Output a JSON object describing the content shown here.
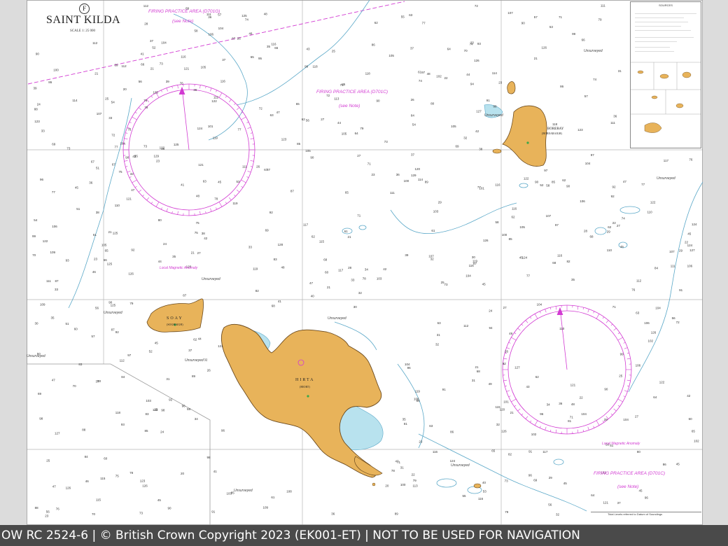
{
  "chart": {
    "title": "SAINT KILDA",
    "scale": "SCALE 1: 25 000",
    "panel_letter": "F"
  },
  "firing_areas": [
    {
      "label": "FIRING PRACTICE AREA (D701G)",
      "note": "(see Note)"
    },
    {
      "label": "FIRING PRACTICE AREA (D701C)",
      "note": "(see Note)"
    },
    {
      "label": "FIRING PRACTICE AREA (D701C)",
      "note": "(see Note)"
    }
  ],
  "magnetic_anomaly": [
    "Local Magnetic Anomaly",
    "Local Magnetic Anomaly"
  ],
  "islands": {
    "hirta": {
      "name": "HIRTA",
      "alt": "(HIORT)"
    },
    "soay": {
      "name": "SOAY",
      "alt": "(SOGHAIGH)"
    },
    "boreray": {
      "name": "BORERAY",
      "alt": "(BOREARAIGH)"
    }
  },
  "unsurveyed_label": "Unsurveyed",
  "sources_heading": "SOURCES",
  "tidal_caption": "Tidal Levels referred to Datum of Soundings",
  "footer_text": "OW RC 2524-6 | © British Crown Copyright 2023 (EK001-ET) | NOT TO BE USED FOR NAVIGATION",
  "colors": {
    "land": "#e8b35a",
    "land_stroke": "#6b4a1e",
    "shallow": "#b8e2ee",
    "magenta": "#d23ad2",
    "footer_bg": "#4a4a4a"
  }
}
